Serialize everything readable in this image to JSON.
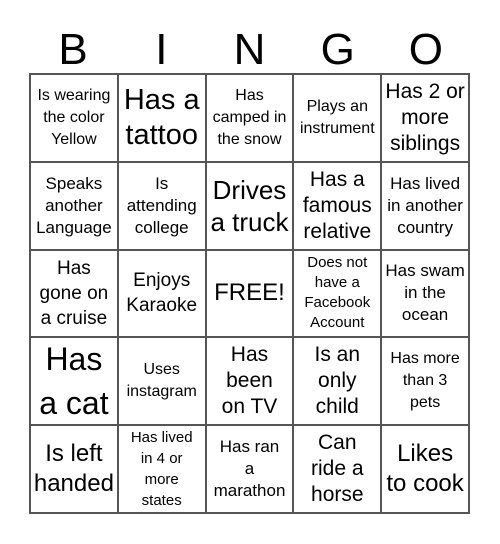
{
  "header": {
    "letters": [
      "B",
      "I",
      "N",
      "G",
      "O"
    ]
  },
  "board": {
    "cells": [
      "Is wearing\nthe color\nYellow",
      "Has a\ntattoo",
      "Has\ncamped in\nthe snow",
      "Plays an\ninstrument",
      "Has 2 or\nmore\nsiblings",
      "Speaks\nanother\nLanguage",
      "Is\nattending\ncollege",
      "Drives\na truck",
      "Has a\nfamous\nrelative",
      "Has lived\nin another\ncountry",
      "Has\ngone on\na cruise",
      "Enjoys\nKaraoke",
      "FREE!",
      "Does not\nhave a\nFacebook\nAccount",
      "Has swam\nin the\nocean",
      "Has\na cat",
      "Uses\ninstagram",
      "Has\nbeen\non TV",
      "Is an\nonly\nchild",
      "Has more\nthan 3\npets",
      "Is left\nhanded",
      "Has lived\nin 4 or\nmore\nstates",
      "Has ran\na\nmarathon",
      "Can\nride a\nhorse",
      "Likes\nto cook"
    ]
  }
}
